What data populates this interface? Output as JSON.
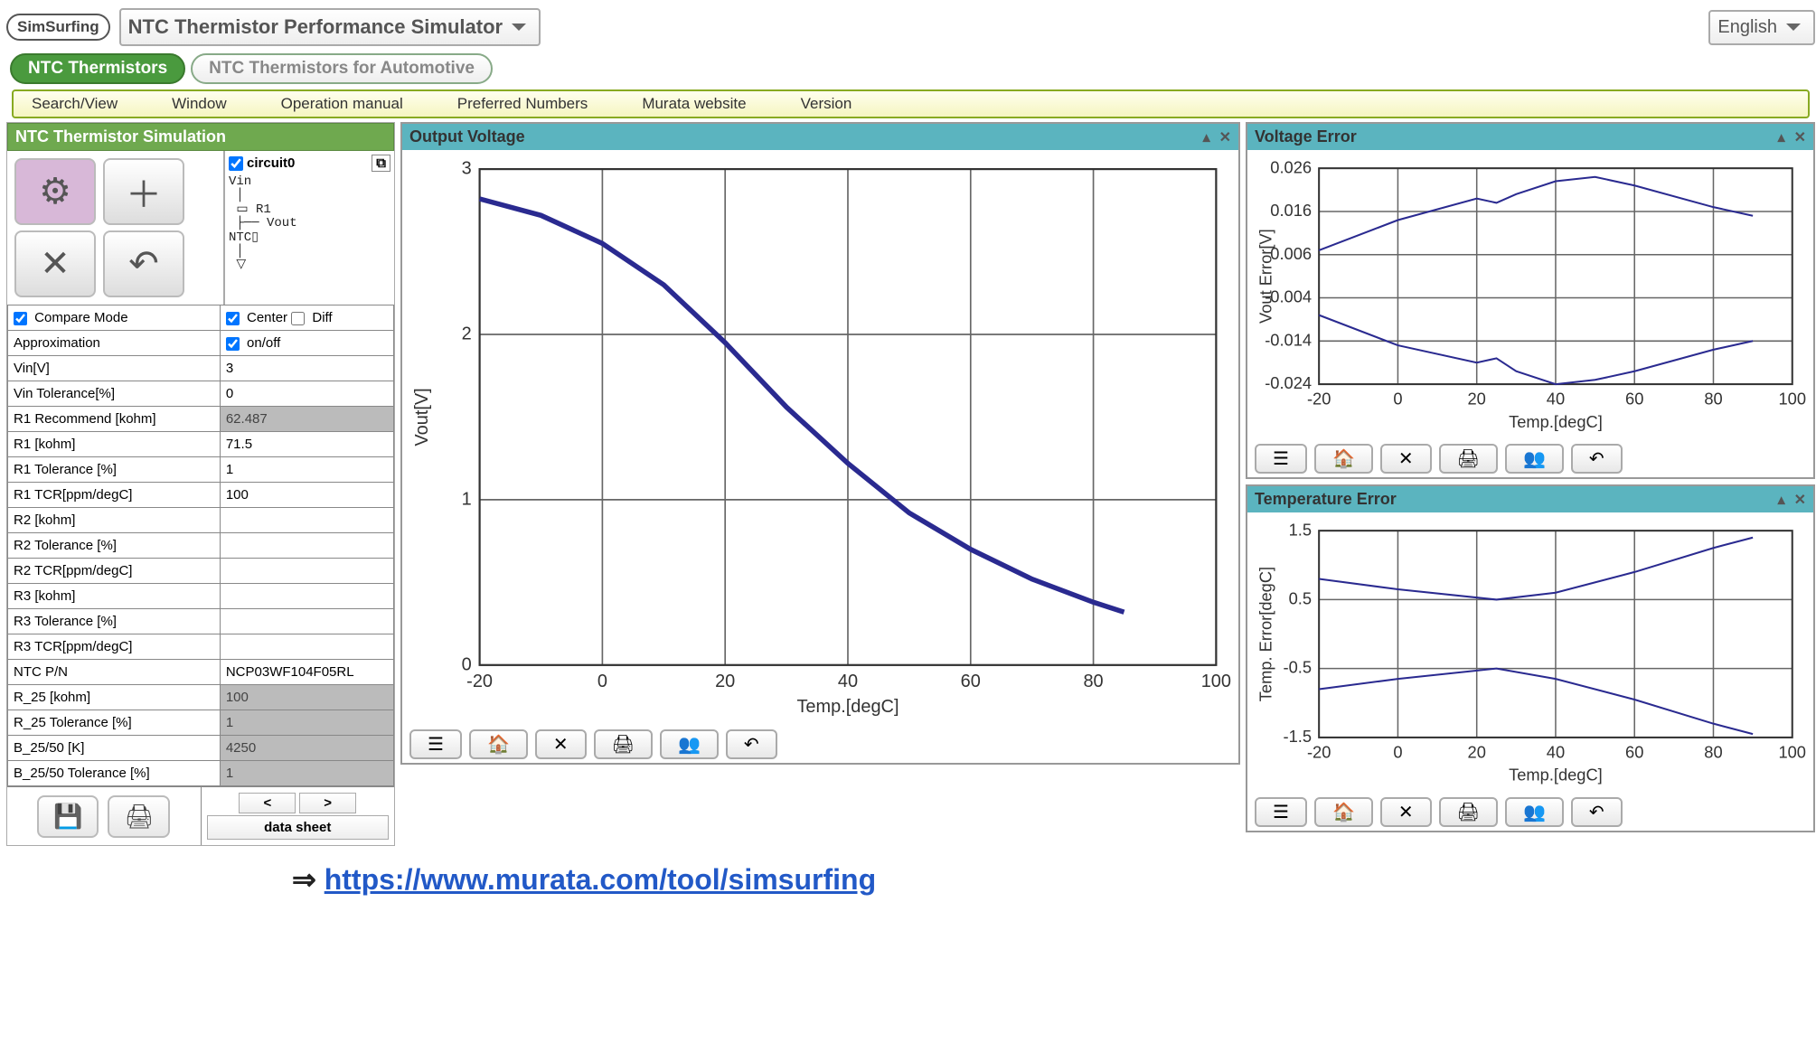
{
  "top": {
    "logo_text": "SimSurfing",
    "main_dropdown": "NTC Thermistor Performance Simulator",
    "language": "English"
  },
  "tabs": {
    "active": "NTC Thermistors",
    "inactive": "NTC Thermistors for Automotive"
  },
  "menu": {
    "items": [
      "Search/View",
      "Window",
      "Operation manual",
      "Preferred Numbers",
      "Murata website",
      "Version"
    ]
  },
  "sidebar": {
    "title": "NTC Thermistor Simulation",
    "circuit_label": "circuit0",
    "circuit_lines": [
      "Vin",
      "R1",
      "Vout",
      "NTC"
    ],
    "params": [
      {
        "label": "Compare Mode",
        "value": "",
        "check_left": true,
        "opts": [
          {
            "label": "Center",
            "checked": true
          },
          {
            "label": "Diff",
            "checked": false
          }
        ]
      },
      {
        "label": "Approximation",
        "value": "",
        "opts": [
          {
            "label": "on/off",
            "checked": true
          }
        ]
      },
      {
        "label": "Vin[V]",
        "value": "3"
      },
      {
        "label": "Vin Tolerance[%]",
        "value": "0"
      },
      {
        "label": "R1 Recommend [kohm]",
        "value": "62.487",
        "grey": true
      },
      {
        "label": "R1 [kohm]",
        "value": "71.5"
      },
      {
        "label": "R1 Tolerance [%]",
        "value": "1"
      },
      {
        "label": "R1 TCR[ppm/degC]",
        "value": "100"
      },
      {
        "label": "R2 [kohm]",
        "value": ""
      },
      {
        "label": "R2 Tolerance [%]",
        "value": ""
      },
      {
        "label": "R2 TCR[ppm/degC]",
        "value": ""
      },
      {
        "label": "R3 [kohm]",
        "value": ""
      },
      {
        "label": "R3 Tolerance [%]",
        "value": ""
      },
      {
        "label": "R3 TCR[ppm/degC]",
        "value": ""
      },
      {
        "label": "NTC P/N",
        "value": "NCP03WF104F05RL"
      },
      {
        "label": "R_25 [kohm]",
        "value": "100",
        "grey": true
      },
      {
        "label": "R_25 Tolerance [%]",
        "value": "1",
        "grey": true
      },
      {
        "label": "B_25/50 [K]",
        "value": "4250",
        "grey": true
      },
      {
        "label": "B_25/50 Tolerance [%]",
        "value": "1",
        "grey": true
      }
    ],
    "nav_prev": "<",
    "nav_next": ">",
    "datasheet": "data sheet"
  },
  "panels": {
    "output_voltage": {
      "title": "Output Voltage",
      "xlabel": "Temp.[degC]",
      "ylabel": "Vout[V]"
    },
    "voltage_error": {
      "title": "Voltage Error",
      "xlabel": "Temp.[degC]",
      "ylabel": "Vout Error[V]"
    },
    "temperature_error": {
      "title": "Temperature Error",
      "xlabel": "Temp.[degC]",
      "ylabel": "Temp. Error[degC]"
    }
  },
  "footer": {
    "arrow": "⇒",
    "url": "https://www.murata.com/tool/simsurfing"
  },
  "chart_data": [
    {
      "id": "output_voltage",
      "type": "line",
      "title": "Output Voltage",
      "xlabel": "Temp.[degC]",
      "ylabel": "Vout[V]",
      "xlim": [
        -20,
        100
      ],
      "ylim": [
        0,
        3
      ],
      "x_ticks": [
        -20,
        0,
        20,
        40,
        60,
        80,
        100
      ],
      "y_ticks": [
        0,
        1,
        2,
        3
      ],
      "series": [
        {
          "name": "Vout",
          "x": [
            -20,
            -10,
            0,
            10,
            20,
            30,
            40,
            50,
            60,
            70,
            80,
            85
          ],
          "values": [
            2.82,
            2.72,
            2.55,
            2.3,
            1.95,
            1.56,
            1.22,
            0.92,
            0.7,
            0.52,
            0.38,
            0.32
          ]
        }
      ]
    },
    {
      "id": "voltage_error",
      "type": "line",
      "title": "Voltage Error",
      "xlabel": "Temp.[degC]",
      "ylabel": "Vout Error[V]",
      "xlim": [
        -20,
        100
      ],
      "ylim": [
        -0.024,
        0.026
      ],
      "x_ticks": [
        -20,
        0,
        20,
        40,
        60,
        80,
        100
      ],
      "y_ticks": [
        -0.024,
        -0.014,
        -0.004,
        0.006,
        0.016,
        0.026
      ],
      "series": [
        {
          "name": "upper",
          "x": [
            -20,
            0,
            20,
            25,
            30,
            40,
            50,
            60,
            80,
            90
          ],
          "values": [
            0.007,
            0.014,
            0.019,
            0.018,
            0.02,
            0.023,
            0.024,
            0.022,
            0.017,
            0.015
          ]
        },
        {
          "name": "lower",
          "x": [
            -20,
            0,
            20,
            25,
            30,
            40,
            50,
            60,
            80,
            90
          ],
          "values": [
            -0.008,
            -0.015,
            -0.019,
            -0.018,
            -0.021,
            -0.024,
            -0.023,
            -0.021,
            -0.016,
            -0.014
          ]
        }
      ]
    },
    {
      "id": "temperature_error",
      "type": "line",
      "title": "Temperature Error",
      "xlabel": "Temp.[degC]",
      "ylabel": "Temp. Error[degC]",
      "xlim": [
        -20,
        100
      ],
      "ylim": [
        -1.5,
        1.5
      ],
      "x_ticks": [
        -20,
        0,
        20,
        40,
        60,
        80,
        100
      ],
      "y_ticks": [
        -1.5,
        -0.5,
        0.5,
        1.5
      ],
      "series": [
        {
          "name": "upper",
          "x": [
            -20,
            0,
            25,
            40,
            60,
            80,
            90
          ],
          "values": [
            0.8,
            0.65,
            0.5,
            0.6,
            0.9,
            1.25,
            1.4
          ]
        },
        {
          "name": "lower",
          "x": [
            -20,
            0,
            25,
            40,
            60,
            80,
            90
          ],
          "values": [
            -0.8,
            -0.65,
            -0.5,
            -0.65,
            -0.95,
            -1.3,
            -1.45
          ]
        }
      ]
    }
  ]
}
